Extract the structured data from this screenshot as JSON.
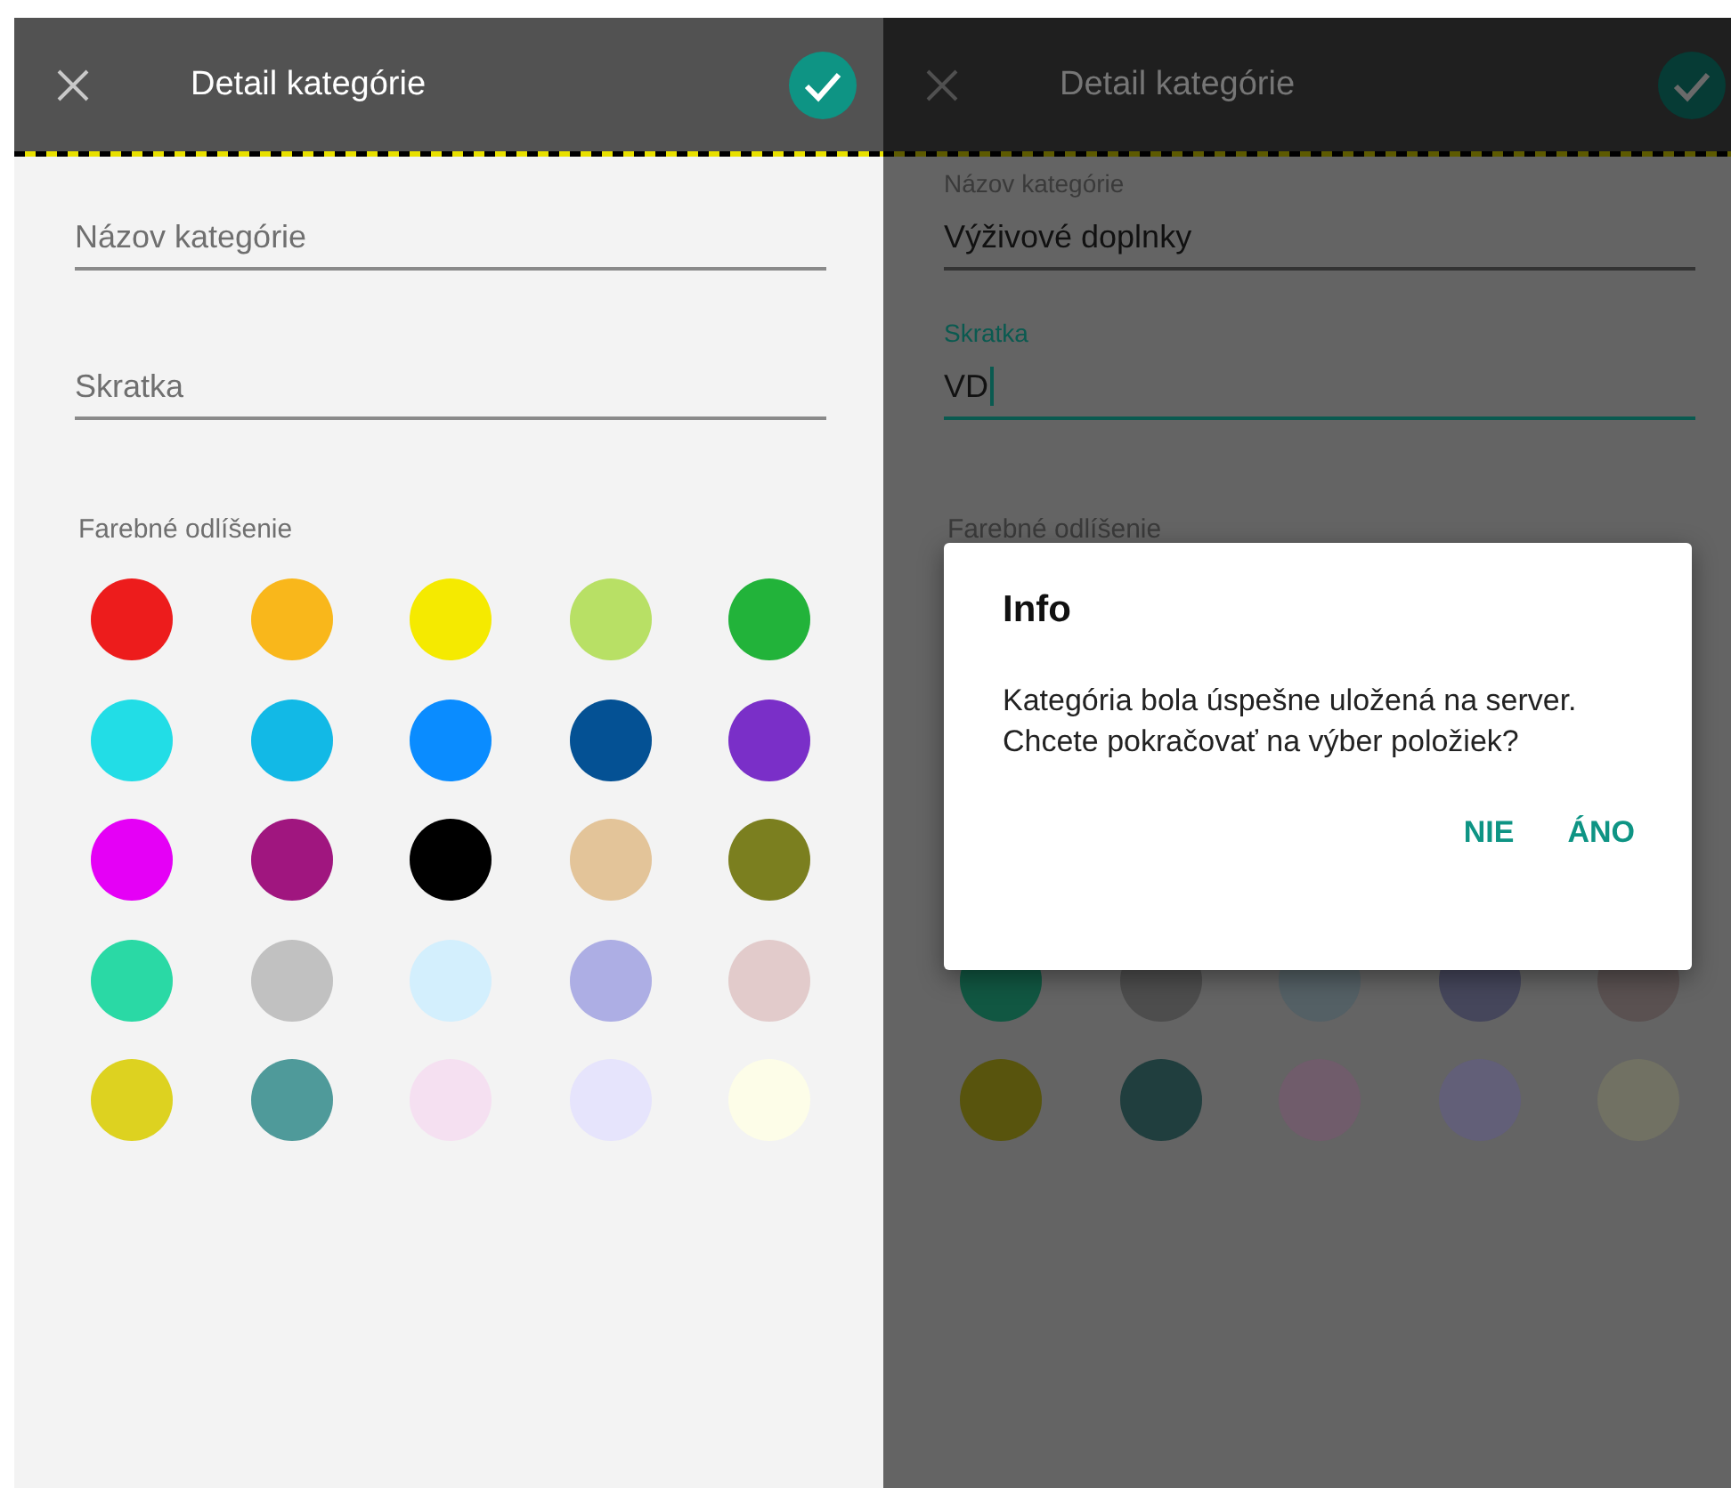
{
  "screens": [
    {
      "title": "Detail kategórie",
      "dimmed": false,
      "fields": [
        {
          "placeholder": "Názov kategórie",
          "focused": false
        },
        {
          "placeholder": "Skratka",
          "focused": false
        }
      ],
      "palette": {
        "label": "Farebné odlíšenie",
        "colors": [
          {
            "color": "#ed1c1c"
          },
          {
            "color": "#f9b71b"
          },
          {
            "color": "#f5ea00"
          },
          {
            "color": "#b8e065"
          },
          {
            "color": "#22b33a"
          },
          {
            "color": "#22dde6"
          },
          {
            "color": "#12b9e6"
          },
          {
            "color": "#0a8cff"
          },
          {
            "color": "#045194"
          },
          {
            "color": "#7a2fc8"
          },
          {
            "color": "#e500f6"
          },
          {
            "color": "#a0167f"
          },
          {
            "color": "#000000"
          },
          {
            "color": "#e3c499"
          },
          {
            "color": "#7b7f1f"
          },
          {
            "color": "#2ad9a5"
          },
          {
            "color": "#c1c1c1"
          },
          {
            "color": "#d3effd"
          },
          {
            "color": "#adaee4"
          },
          {
            "color": "#e2cbcb"
          },
          {
            "color": "#ddd220"
          },
          {
            "color": "#4f9a9a"
          },
          {
            "color": "#f5e0f1"
          },
          {
            "color": "#e6e4fc"
          },
          {
            "color": "#fdfde8"
          }
        ]
      }
    },
    {
      "title": "Detail kategórie",
      "dimmed": true,
      "fields": [
        {
          "label": "Názov kategórie",
          "value": "Výživové doplnky",
          "focused": false
        },
        {
          "label": "Skratka",
          "value": "VD",
          "focused": true
        }
      ],
      "palette": {
        "label": "Farebné odlíšenie",
        "colors": [
          {
            "color": "#115742"
          },
          {
            "color": "#4d4d4d"
          },
          {
            "color": "#546065"
          },
          {
            "color": "#45465b"
          },
          {
            "color": "#5a5151"
          },
          {
            "color": "#58540d"
          },
          {
            "color": "#203e3e"
          },
          {
            "color": "#705c6b"
          },
          {
            "color": "#625f78"
          },
          {
            "color": "#717163"
          }
        ]
      },
      "dialog": {
        "title": "Info",
        "message": "Kategória bola úspešne uložená na server. Chcete pokračovať na výber položiek?",
        "buttons": [
          "NIE",
          "ÁNO"
        ]
      }
    }
  ]
}
